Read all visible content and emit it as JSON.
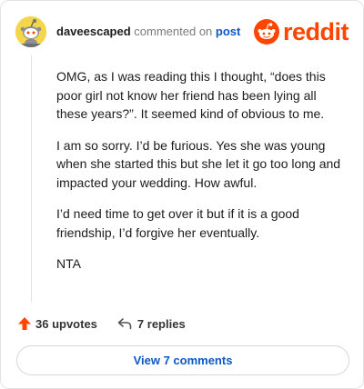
{
  "comment": {
    "username": "daveescaped",
    "action_text": "commented on",
    "post_link": "post",
    "paragraphs": [
      "OMG, as I was reading this I thought, “does this poor girl not know her friend has been lying all these years?”. It seemed kind of obvious to me.",
      "I am so sorry. I’d be furious. Yes she was young when she started this but she let it go too long and impacted your wedding. How awful.",
      "I’d need time to get over it but if it is a good friendship, I’d forgive her eventually.",
      "NTA"
    ]
  },
  "brand": {
    "name": "reddit",
    "color": "#ff4500"
  },
  "footer": {
    "upvotes": "36 upvotes",
    "replies": "7 replies"
  },
  "view_button": {
    "label": "View 7 comments"
  }
}
